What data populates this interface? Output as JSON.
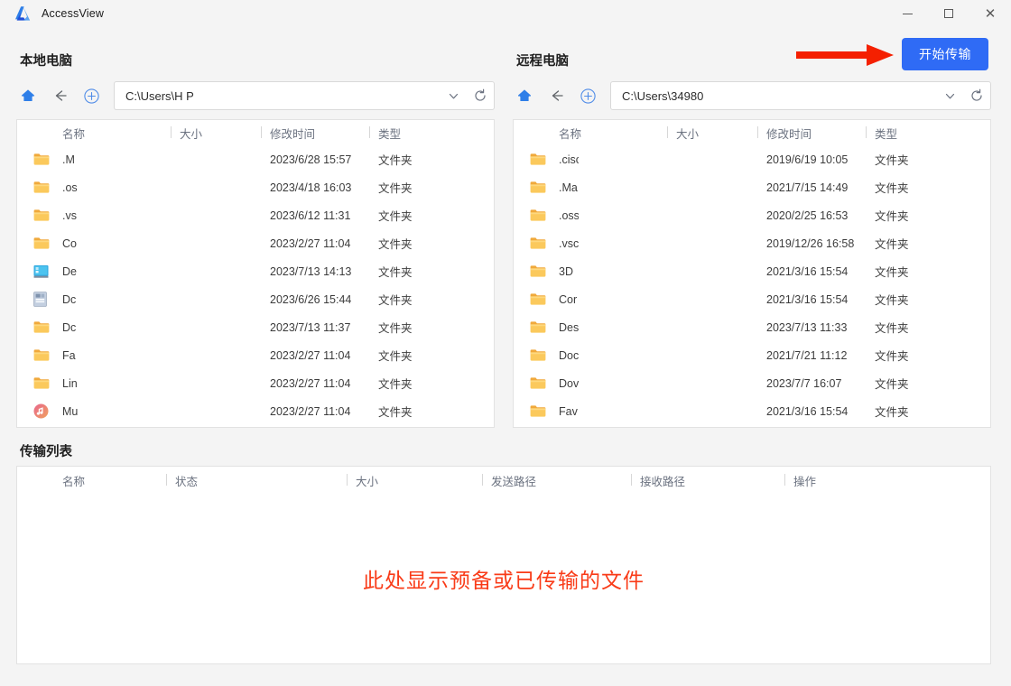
{
  "window": {
    "app_title": "AccessView",
    "logo_icon": "azure-a-logo",
    "controls": [
      {
        "name": "minimize",
        "icon": "minimize-icon"
      },
      {
        "name": "maximize",
        "icon": "maximize-icon"
      },
      {
        "name": "close",
        "icon": "close-icon"
      }
    ]
  },
  "toolbar": {
    "start_transfer_label": "开始传输",
    "start_transfer_color": "#2f6bf5",
    "annotation_arrow_color": "#f42000"
  },
  "local": {
    "title": "本地电脑",
    "path_value": "C:\\Users\\H P",
    "nav": {
      "home_icon": "home-icon",
      "back_icon": "arrow-left-icon",
      "add_icon": "plus-circle-icon",
      "dropdown_icon": "chevron-down-icon",
      "refresh_icon": "refresh-icon"
    },
    "columns": [
      "名称",
      "大小",
      "修改时间",
      "类型"
    ],
    "rows": [
      {
        "icon": "folder-icon",
        "name": ".M",
        "size": "",
        "modified": "2023/6/28 15:57",
        "type": "文件夹"
      },
      {
        "icon": "folder-icon",
        "name": ".os",
        "size": "",
        "modified": "2023/4/18 16:03",
        "type": "文件夹"
      },
      {
        "icon": "folder-icon",
        "name": ".vs",
        "size": "",
        "modified": "2023/6/12 11:31",
        "type": "文件夹"
      },
      {
        "icon": "folder-icon",
        "name": "Co",
        "size": "",
        "modified": "2023/2/27 11:04",
        "type": "文件夹"
      },
      {
        "icon": "desktop-icon",
        "name": "De",
        "size": "",
        "modified": "2023/7/13 14:13",
        "type": "文件夹"
      },
      {
        "icon": "document-icon",
        "name": "Dc",
        "size": "",
        "modified": "2023/6/26 15:44",
        "type": "文件夹"
      },
      {
        "icon": "folder-icon",
        "name": "Dc",
        "size": "",
        "modified": "2023/7/13 11:37",
        "type": "文件夹"
      },
      {
        "icon": "folder-icon",
        "name": "Fa",
        "size": "",
        "modified": "2023/2/27 11:04",
        "type": "文件夹"
      },
      {
        "icon": "folder-icon",
        "name": "Lin",
        "size": "",
        "modified": "2023/2/27 11:04",
        "type": "文件夹"
      },
      {
        "icon": "music-icon",
        "name": "Mu",
        "size": "",
        "modified": "2023/2/27 11:04",
        "type": "文件夹"
      }
    ]
  },
  "remote": {
    "title": "远程电脑",
    "path_value": "C:\\Users\\34980",
    "nav": {
      "home_icon": "home-icon",
      "back_icon": "arrow-left-icon",
      "add_icon": "plus-circle-icon",
      "dropdown_icon": "chevron-down-icon",
      "refresh_icon": "refresh-icon"
    },
    "columns": [
      "名称",
      "大小",
      "修改时间",
      "类型"
    ],
    "rows": [
      {
        "icon": "folder-icon",
        "name": ".cisc",
        "size": "",
        "modified": "2019/6/19 10:05",
        "type": "文件夹"
      },
      {
        "icon": "folder-icon",
        "name": ".Ma",
        "size": "",
        "modified": "2021/7/15 14:49",
        "type": "文件夹"
      },
      {
        "icon": "folder-icon",
        "name": ".oss",
        "size": "",
        "modified": "2020/2/25 16:53",
        "type": "文件夹"
      },
      {
        "icon": "folder-icon",
        "name": ".vsc",
        "size": "",
        "modified": "2019/12/26 16:58",
        "type": "文件夹"
      },
      {
        "icon": "folder-icon",
        "name": "3D",
        "size": "",
        "modified": "2021/3/16 15:54",
        "type": "文件夹"
      },
      {
        "icon": "folder-icon",
        "name": "Cor",
        "size": "",
        "modified": "2021/3/16 15:54",
        "type": "文件夹"
      },
      {
        "icon": "folder-icon",
        "name": "Des",
        "size": "",
        "modified": "2023/7/13 11:33",
        "type": "文件夹"
      },
      {
        "icon": "folder-icon",
        "name": "Doc",
        "size": "",
        "modified": "2021/7/21 11:12",
        "type": "文件夹"
      },
      {
        "icon": "folder-icon",
        "name": "Dov",
        "size": "",
        "modified": "2023/7/7 16:07",
        "type": "文件夹"
      },
      {
        "icon": "folder-icon",
        "name": "Fav",
        "size": "",
        "modified": "2021/3/16 15:54",
        "type": "文件夹"
      }
    ]
  },
  "transfer": {
    "title": "传输列表",
    "columns": [
      "名称",
      "状态",
      "大小",
      "发送路径",
      "接收路径",
      "操作"
    ],
    "empty_message": "此处显示预备或已传输的文件",
    "empty_message_color": "#f93b18",
    "rows": []
  }
}
